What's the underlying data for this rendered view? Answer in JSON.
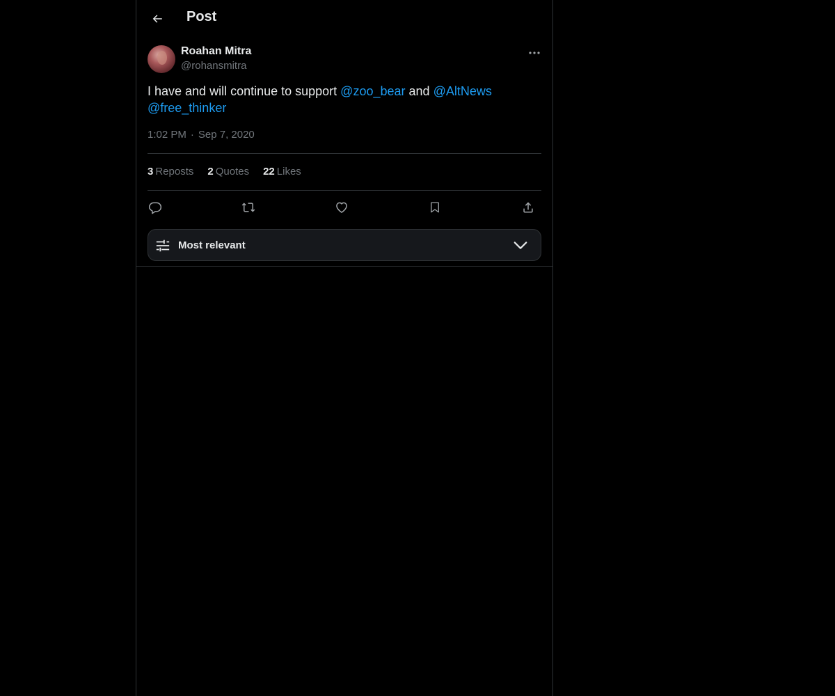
{
  "header": {
    "title": "Post",
    "back_icon": "arrow-left-icon"
  },
  "post": {
    "author": {
      "name": "Roahan Mitra",
      "handle": "@rohansmitra",
      "avatar_icon": "avatar"
    },
    "more_icon": "more-horizontal-icon",
    "text": {
      "part1": "I have and will continue to support ",
      "mention1": "@zoo_bear",
      "part2": " and ",
      "mention2": "@AltNews",
      "mention3": "@free_thinker"
    },
    "time": "1:02 PM",
    "separator": "·",
    "date": "Sep 7, 2020"
  },
  "stats": {
    "reposts": {
      "count": "3",
      "label": "Reposts"
    },
    "quotes": {
      "count": "2",
      "label": "Quotes"
    },
    "likes": {
      "count": "22",
      "label": "Likes"
    }
  },
  "actions": {
    "reply_icon": "reply-icon",
    "repost_icon": "repost-icon",
    "like_icon": "heart-icon",
    "bookmark_icon": "bookmark-icon",
    "share_icon": "share-icon"
  },
  "sort": {
    "label": "Most relevant",
    "icon": "sliders-icon",
    "chevron": "chevron-down-icon"
  },
  "colors": {
    "background": "#000000",
    "text": "#e7e9ea",
    "muted": "#71767b",
    "accent": "#1d9bf0",
    "border": "#2f3336"
  }
}
